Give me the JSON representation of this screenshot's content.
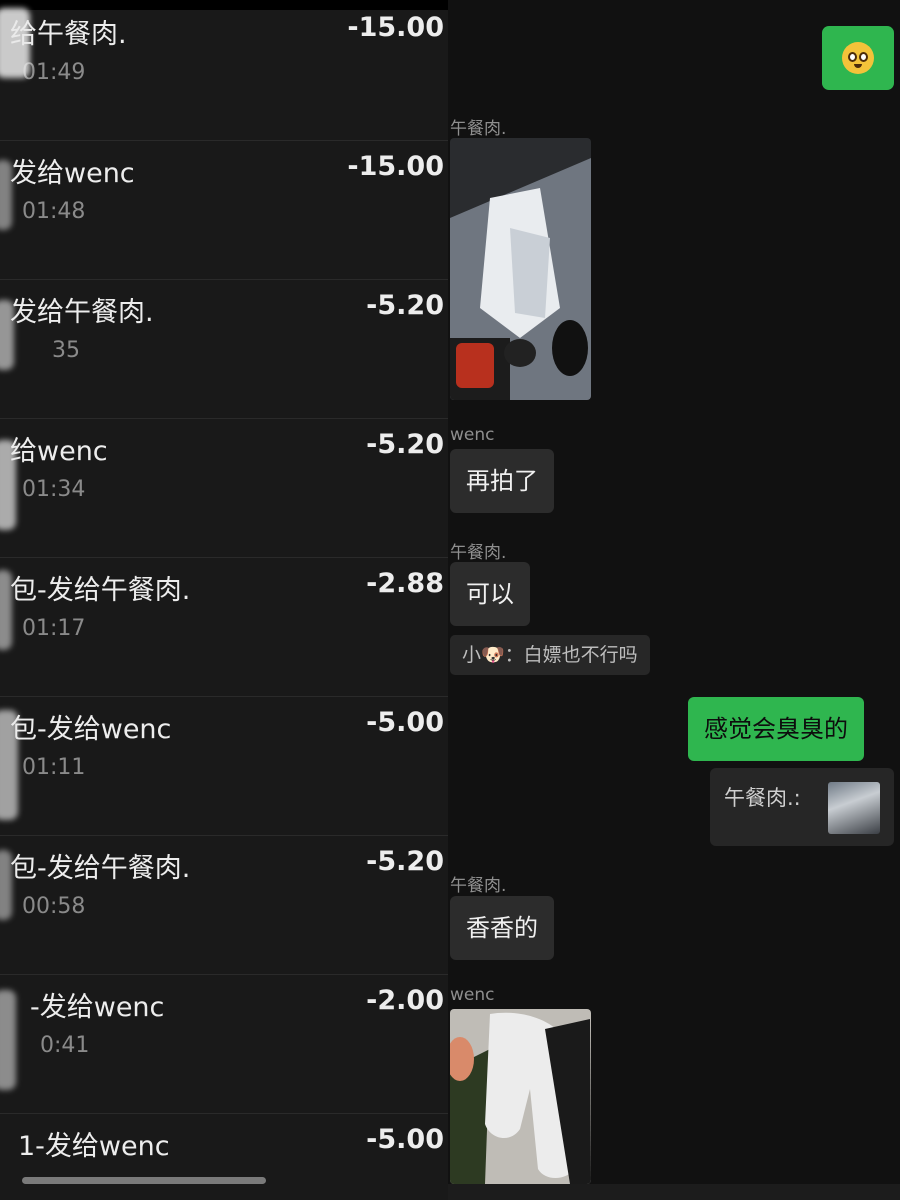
{
  "transactions": [
    {
      "title": "给午餐肉.",
      "time": "01:49",
      "amount": "-15.00"
    },
    {
      "title": "发给wenc",
      "time": "01:48",
      "amount": "-15.00"
    },
    {
      "title": "发给午餐肉.",
      "time": "35",
      "amount": "-5.20"
    },
    {
      "title": "给wenc",
      "time": "01:34",
      "amount": "-5.20"
    },
    {
      "title": "包-发给午餐肉.",
      "time": "01:17",
      "amount": "-2.88"
    },
    {
      "title": "包-发给wenc",
      "time": "01:11",
      "amount": "-5.00"
    },
    {
      "title": "包-发给午餐肉.",
      "time": "00:58",
      "amount": "-5.20"
    },
    {
      "title": "-发给wenc",
      "time": "0:41",
      "amount": "-2.00"
    },
    {
      "title": "1-发给wenc",
      "time": "",
      "amount": "-5.00"
    }
  ],
  "chat": {
    "sender_a": "午餐肉.",
    "sender_b": "wenc",
    "msg_1": "再拍了",
    "msg_2": "可以",
    "quote": "小🐶：白嫖也不行吗",
    "my_msg": "感觉会臭臭的",
    "ref_label": "午餐肉.:",
    "msg_3": "香香的"
  },
  "colors": {
    "my_bubble": "#2fb64f",
    "other_bubble": "#2c2c2c",
    "background": "#111111"
  },
  "icons": [
    "pleading-face-emoji-icon",
    "photo-thumbnail-icon"
  ]
}
